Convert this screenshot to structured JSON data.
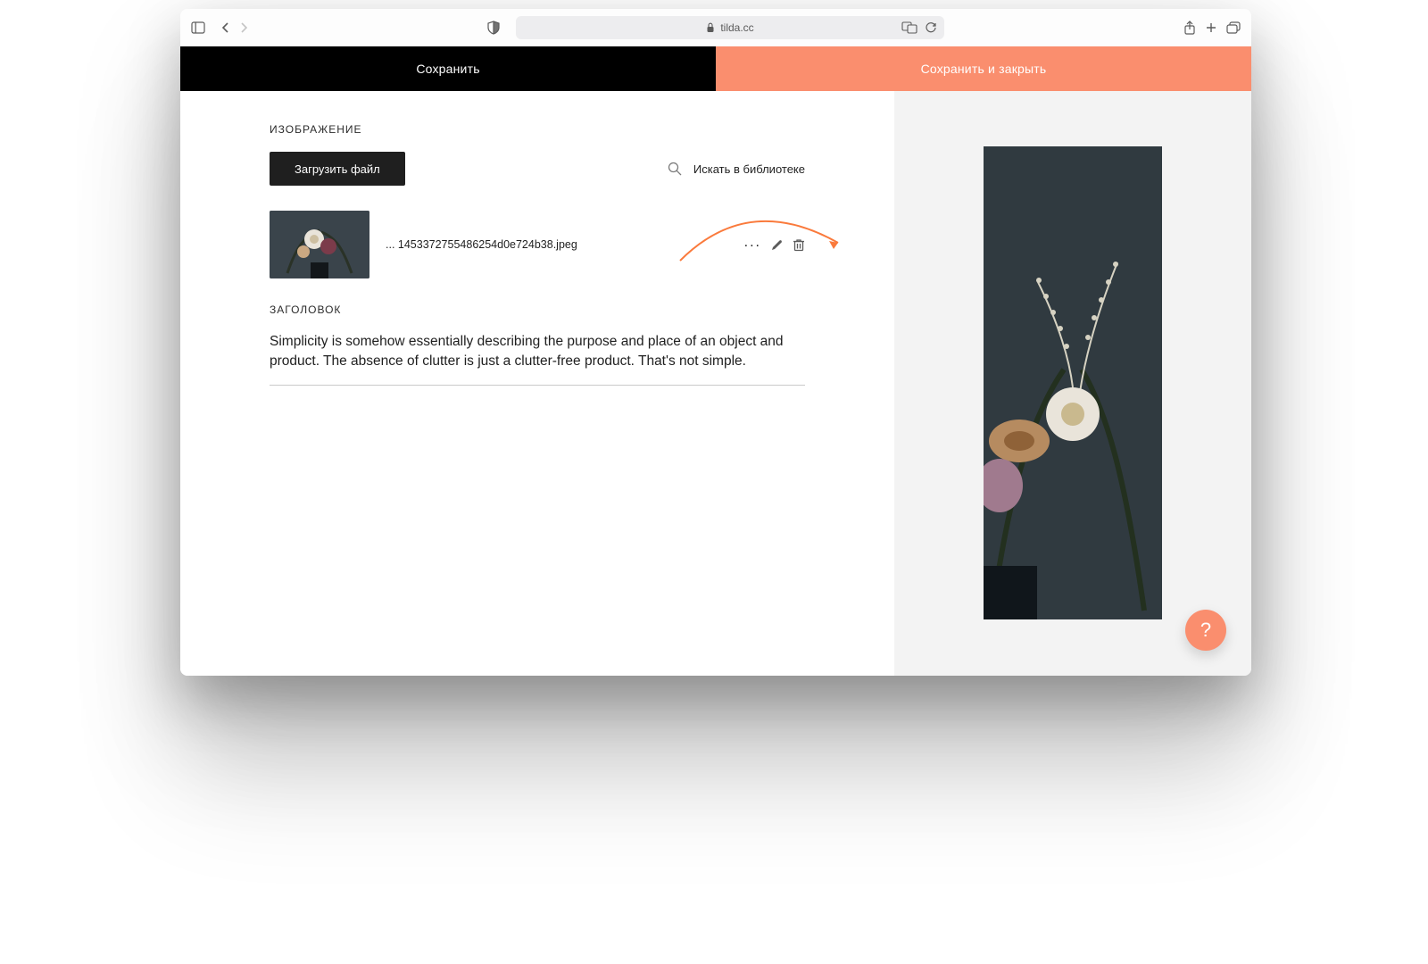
{
  "browser": {
    "url_host": "tilda.cc"
  },
  "topbar": {
    "save_label": "Сохранить",
    "save_close_label": "Сохранить и закрыть"
  },
  "image_section": {
    "label": "ИЗОБРАЖЕНИЕ",
    "upload_label": "Загрузить файл",
    "library_label": "Искать в библиотеке",
    "file_name": "... 1453372755486254d0e724b38.jpeg"
  },
  "title_section": {
    "label": "ЗАГОЛОВОК",
    "value": "Simplicity is somehow essentially describing the purpose and place of an object and product. The absence of clutter is just a clutter-free product. That's not simple."
  },
  "help": {
    "glyph": "?"
  }
}
